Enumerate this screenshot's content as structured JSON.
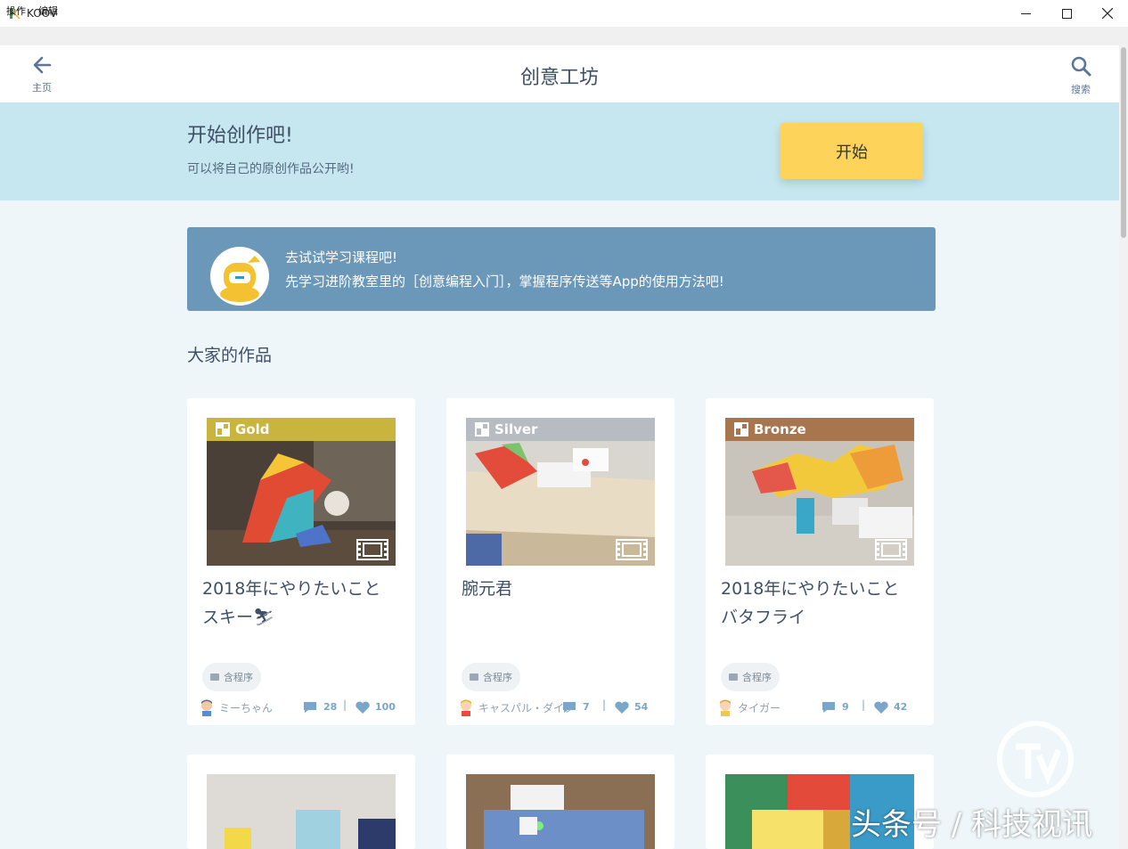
{
  "window": {
    "title": "KOOV",
    "minimize": "—",
    "maximize": "☐",
    "close": "✕"
  },
  "menu": [
    "操作",
    "编辑"
  ],
  "header": {
    "back_label": "主页",
    "title": "创意工坊",
    "search_label": "搜索"
  },
  "banner": {
    "title": "开始创作吧!",
    "subtitle": "可以将自己的原创作品公开哟!",
    "button": "开始"
  },
  "lesson": {
    "line1": "去试试学习课程吧!",
    "line2": "先学习进阶教室里的［创意编程入门］，掌握程序传送等App的使用方法吧!"
  },
  "section_title": "大家的作品",
  "works": [
    {
      "medal": "Gold",
      "medal_color": "#c9b43d",
      "title": "2018年にやりたいことスキー⛷",
      "tag": "含程序",
      "user": "ミーちゃん",
      "comments": "28",
      "likes": "100"
    },
    {
      "medal": "Silver",
      "medal_color": "#b7bcc2",
      "title": "腕元君",
      "tag": "含程序",
      "user": "キャスパル・ダイクン",
      "comments": "7",
      "likes": "54"
    },
    {
      "medal": "Bronze",
      "medal_color": "#a8764e",
      "title": "2018年にやりたいこと　バタフライ",
      "tag": "含程序",
      "user": "タイガー",
      "comments": "9",
      "likes": "42"
    }
  ],
  "watermark": "头条号 / 科技视讯"
}
